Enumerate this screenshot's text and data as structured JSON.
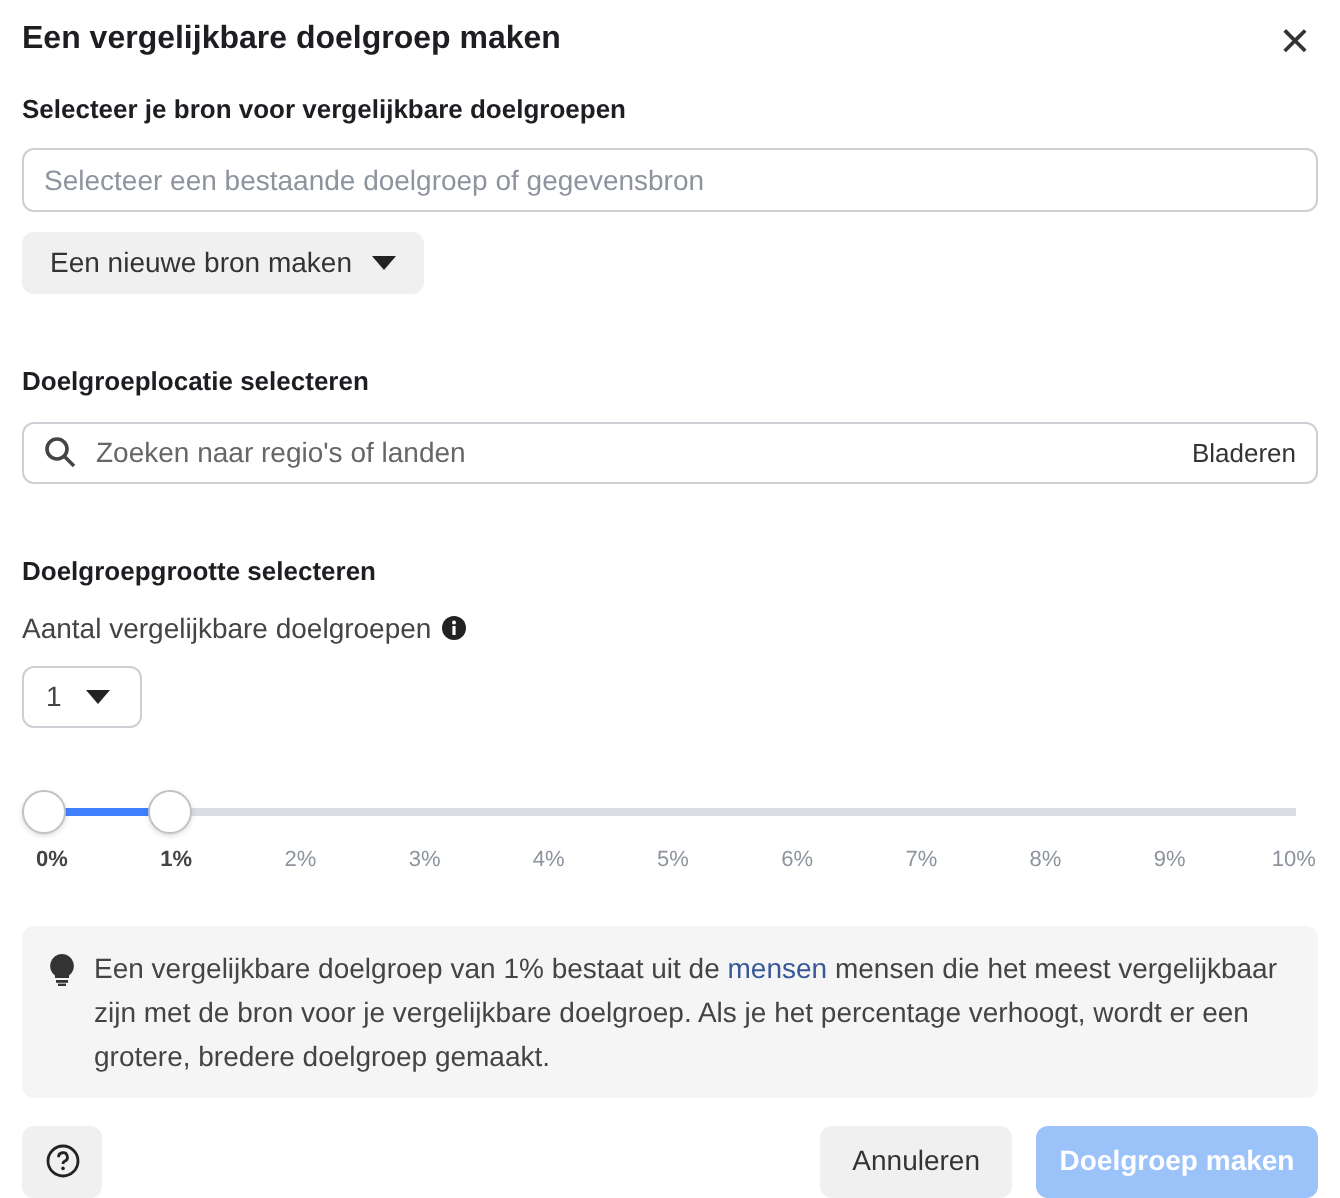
{
  "dialog": {
    "title": "Een vergelijkbare doelgroep maken",
    "close": "×"
  },
  "source": {
    "label": "Selecteer je bron voor vergelijkbare doelgroepen",
    "placeholder": "Selecteer een bestaande doelgroep of gegevensbron",
    "button": "Een nieuwe bron maken"
  },
  "location": {
    "label": "Doelgroeplocatie selecteren",
    "placeholder": "Zoeken naar regio's of landen",
    "browse": "Bladeren"
  },
  "size": {
    "label": "Doelgroepgrootte selecteren",
    "count_label": "Aantal vergelijkbare doelgroepen",
    "count_value": "1",
    "slider": {
      "level": 0.1,
      "ticks": [
        {
          "label": "0%",
          "selected": true
        },
        {
          "label": "1%",
          "selected": true
        },
        {
          "label": "2%",
          "selected": false
        },
        {
          "label": "3%",
          "selected": false
        },
        {
          "label": "4%",
          "selected": false
        },
        {
          "label": "5%",
          "selected": false
        },
        {
          "label": "6%",
          "selected": false
        },
        {
          "label": "7%",
          "selected": false
        },
        {
          "label": "8%",
          "selected": false
        },
        {
          "label": "9%",
          "selected": false
        },
        {
          "label": "10%",
          "selected": false
        }
      ]
    }
  },
  "info": {
    "text_before": "Een vergelijkbare doelgroep van 1% bestaat uit de",
    "link": "mensen",
    "text_after": "mensen die het meest vergelijkbaar zijn met de bron voor je vergelijkbare doelgroep. Als je het percentage verhoogt, wordt er een grotere, bredere doelgroep gemaakt."
  },
  "footer": {
    "cancel": "Annuleren",
    "submit": {
      "label": "Doelgroep maken",
      "disabled": true
    }
  }
}
